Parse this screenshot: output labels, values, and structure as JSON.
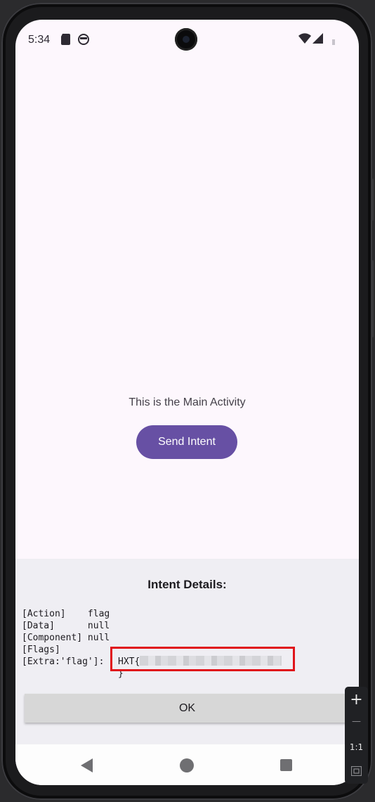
{
  "status_bar": {
    "time": "5:34",
    "icons": [
      "sd-card-icon",
      "system-face-icon",
      "wifi-icon",
      "signal-icon",
      "battery-icon"
    ]
  },
  "main": {
    "text": "This is the Main Activity",
    "send_button_label": "Send Intent"
  },
  "dialog": {
    "title": "Intent Details:",
    "lines": [
      {
        "key": "[Action]    ",
        "value": "flag"
      },
      {
        "key": "[Data]      ",
        "value": "null"
      },
      {
        "key": "[Component] ",
        "value": "null"
      },
      {
        "key": "[Flags]",
        "value": ""
      }
    ],
    "extra_key": "[Extra:'flag']:",
    "extra_value_prefix": "HXT{",
    "extra_value_suffix": "}",
    "ok_label": "OK"
  },
  "emulator_zoom": {
    "plus": "+",
    "minus": "—",
    "ratio": "1:1"
  },
  "colors": {
    "primary": "#6750a4",
    "highlight": "#e0141a",
    "background": "#fdf7fd",
    "sheet": "#efeef3"
  }
}
